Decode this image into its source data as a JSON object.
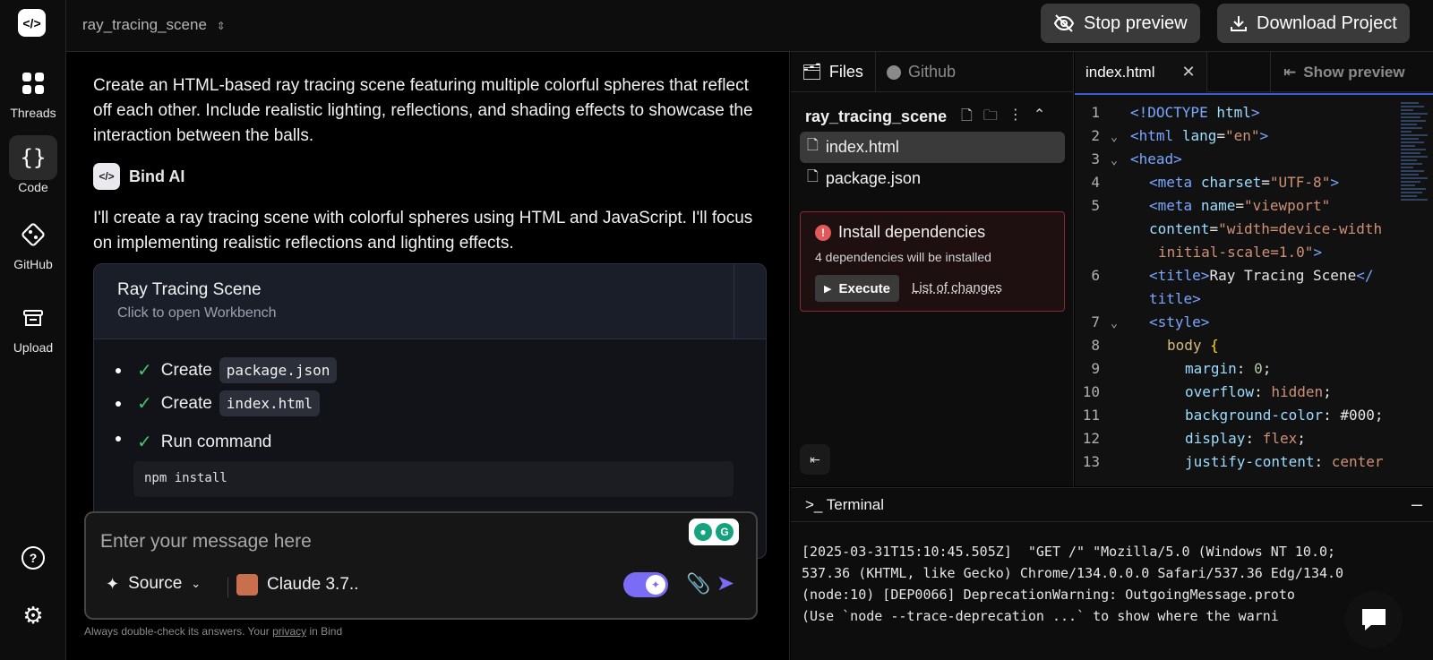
{
  "nav": {
    "items": [
      {
        "label": "Threads",
        "icon": "grid-icon"
      },
      {
        "label": "Code",
        "icon": "braces-icon"
      },
      {
        "label": "GitHub",
        "icon": "github-icon"
      },
      {
        "label": "Upload",
        "icon": "upload-icon"
      }
    ],
    "help_icon": "help-icon",
    "settings_icon": "gear-icon"
  },
  "header": {
    "project": "ray_tracing_scene",
    "stop_preview": "Stop preview",
    "download": "Download Project"
  },
  "chat": {
    "user_message": "Create an HTML-based ray tracing scene featuring multiple colorful spheres that reflect off each other. Include realistic lighting, reflections, and shading effects to showcase the interaction between the balls.",
    "assistant_name": "Bind AI",
    "assistant_message": "I'll create a ray tracing scene with colorful spheres using HTML and JavaScript. I'll focus on implementing realistic reflections and lighting effects.",
    "workbench": {
      "title": "Ray Tracing Scene",
      "subtitle": "Click to open Workbench",
      "steps": [
        {
          "action": "Create",
          "target": "package.json"
        },
        {
          "action": "Create",
          "target": "index.html"
        },
        {
          "action": "Run command",
          "target": ""
        }
      ],
      "command": "npm install"
    }
  },
  "composer": {
    "placeholder": "Enter your message here",
    "source_label": "Source",
    "model_label": "Claude 3.7..",
    "disclaimer_pre": "Always double-check its answers. Your ",
    "disclaimer_link": "privacy",
    "disclaimer_post": " in Bind"
  },
  "files": {
    "tab_files": "Files",
    "tab_github": "Github",
    "project": "ray_tracing_scene",
    "list": [
      "index.html",
      "package.json"
    ],
    "active": "index.html",
    "deps": {
      "title": "Install dependencies",
      "subtitle": "4 dependencies will be installed",
      "execute": "Execute",
      "changes": "List of changes"
    }
  },
  "editor": {
    "tab": "index.html",
    "show_preview": "Show preview",
    "line_numbers": [
      "1",
      "2",
      "3",
      "4",
      "5",
      "6",
      "7",
      "8",
      "9",
      "10",
      "11",
      "12",
      "13"
    ]
  },
  "terminal": {
    "title": ">_ Terminal",
    "lines": [
      "[2025-03-31T15:10:45.505Z]  \"GET /\" \"Mozilla/5.0 (Windows NT 10.0;",
      "537.36 (KHTML, like Gecko) Chrome/134.0.0.0 Safari/537.36 Edg/134.0",
      "(node:10) [DEP0066] DeprecationWarning: OutgoingMessage.proto",
      "(Use `node --trace-deprecation ...` to show where the warni"
    ]
  },
  "colors": {
    "accent": "#7b6cf6",
    "success": "#45c46c",
    "error": "#e05a5a"
  }
}
